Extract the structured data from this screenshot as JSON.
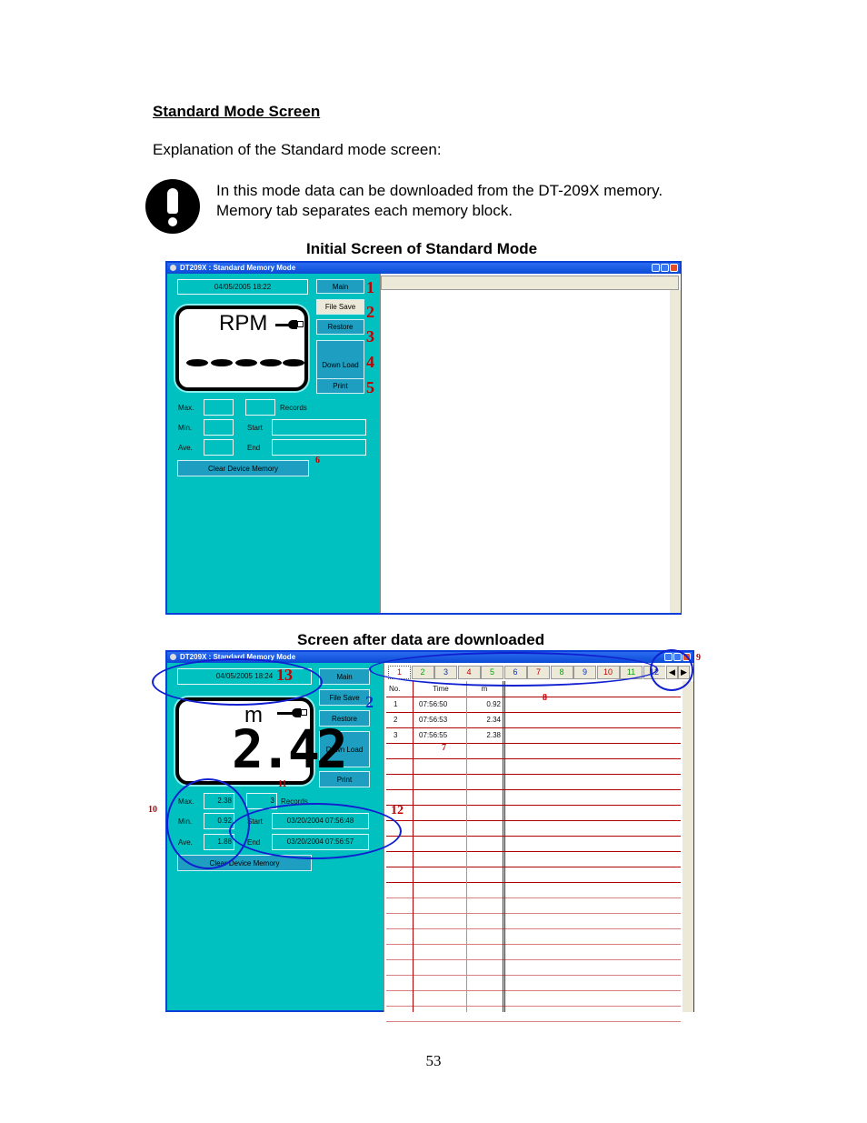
{
  "doc": {
    "heading": "Standard Mode Screen",
    "intro": "Explanation of the Standard mode screen:",
    "note_icon": "exclamation-circle-icon",
    "note_lines": [
      "In this mode data can be downloaded from the DT-209X memory.",
      "Memory tab separates each memory block."
    ],
    "caption_initial": "Initial Screen of Standard Mode",
    "caption_after": "Screen after data are downloaded",
    "page_number": "53"
  },
  "window_common": {
    "title": "DT209X : Standard Memory Mode",
    "buttons": {
      "main": "Main",
      "file_save": "File Save",
      "restore": "Restore",
      "download": "Down Load",
      "print": "Print",
      "clear_memory": "Clear Device Memory"
    },
    "labels": {
      "max": "Max.",
      "min": "Min.",
      "ave": "Ave.",
      "records": "Records",
      "start": "Start",
      "end": "End"
    }
  },
  "screen1": {
    "datetime": "04/05/2005 18:22",
    "unit": "RPM",
    "lcd_value": "-----",
    "callouts": [
      "1",
      "2",
      "3",
      "4",
      "5",
      "6"
    ]
  },
  "screen2": {
    "datetime": "04/05/2005 18:24",
    "unit": "m",
    "lcd_value": "2.42",
    "max": "2.38",
    "min": "0.92",
    "ave": "1.88",
    "records": "3",
    "start": "03/20/2004 07:56:48",
    "end": "03/20/2004 07:56:57",
    "tabs": [
      {
        "label": "1",
        "color": "#c00000"
      },
      {
        "label": "2",
        "color": "#10a010"
      },
      {
        "label": "3",
        "color": "#1030c0"
      },
      {
        "label": "4",
        "color": "#c00000"
      },
      {
        "label": "5",
        "color": "#10a010"
      },
      {
        "label": "6",
        "color": "#1030c0"
      },
      {
        "label": "7",
        "color": "#c00000"
      },
      {
        "label": "8",
        "color": "#10a010"
      },
      {
        "label": "9",
        "color": "#1030c0"
      },
      {
        "label": "10",
        "color": "#c00000"
      },
      {
        "label": "11",
        "color": "#10a010"
      },
      {
        "label": "12",
        "color": "#1030c0"
      }
    ],
    "scroll_left_icon": "arrow-left-icon",
    "scroll_right_icon": "arrow-right-icon",
    "table": {
      "headers": [
        "No.",
        "Time",
        "m"
      ],
      "rows": [
        [
          "1",
          "07:56:50",
          "0.92"
        ],
        [
          "2",
          "07:56:53",
          "2.34"
        ],
        [
          "3",
          "07:56:55",
          "2.38"
        ]
      ]
    },
    "callouts": {
      "c2": "2",
      "c7": "7",
      "c8": "8",
      "c9": "9",
      "c10": "10",
      "c11": "11",
      "c12": "12",
      "c13": "13"
    }
  }
}
